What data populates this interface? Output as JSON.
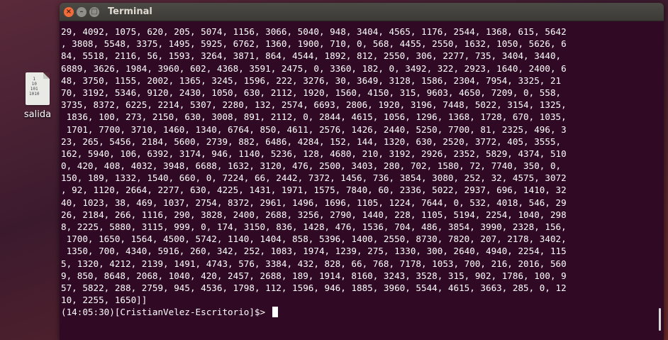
{
  "desktop": {
    "icon_label": "salida",
    "icon_glyph": "1\n10\n101\n1010"
  },
  "window": {
    "title": "Terminal",
    "close_glyph": "×",
    "min_glyph": "–",
    "max_glyph": "□"
  },
  "terminal": {
    "lines": [
      "29, 4092, 1075, 620, 205, 5074, 1156, 3066, 5040, 948, 3404, 4565, 1176, 2544, 1368, 615, 5642",
      ", 3808, 5548, 3375, 1495, 5925, 6762, 1360, 1900, 710, 0, 568, 4455, 2550, 1632, 1050, 5626, 6",
      "84, 5518, 2116, 56, 1593, 3264, 3871, 864, 4544, 1892, 812, 2550, 306, 2277, 735, 3404, 3440,",
      "6889, 3626, 1984, 3960, 602, 4368, 3591, 2475, 0, 3360, 182, 0, 3492, 322, 2923, 1640, 2400, 6",
      "48, 3750, 1155, 2002, 1365, 3245, 1596, 222, 3276, 30, 3649, 3128, 1586, 2304, 7954, 3325, 21",
      "70, 3192, 5346, 9120, 2430, 1050, 630, 2112, 1920, 1560, 4150, 315, 9603, 4650, 7209, 0, 558,",
      "3735, 8372, 6225, 2214, 5307, 2280, 132, 2574, 6693, 2806, 1920, 3196, 7448, 5022, 3154, 1325,",
      " 1836, 100, 273, 2150, 630, 3008, 891, 2112, 0, 2844, 4615, 1056, 1296, 1368, 1728, 670, 1035,",
      " 1701, 7700, 3710, 1460, 1340, 6764, 850, 4611, 2576, 1426, 2440, 5250, 7700, 81, 2325, 496, 3",
      "23, 265, 5456, 2184, 5600, 2739, 882, 6486, 4284, 152, 144, 1320, 630, 2520, 3772, 405, 3555,",
      "162, 5940, 106, 6392, 3174, 946, 1140, 5236, 128, 4680, 210, 3192, 2926, 2352, 5829, 4374, 510",
      "0, 420, 408, 4032, 3948, 6688, 1632, 3120, 476, 2500, 3403, 280, 702, 1580, 72, 7740, 350, 0,",
      "150, 189, 1332, 1540, 660, 0, 7224, 66, 2442, 7372, 1456, 736, 3854, 3080, 252, 32, 4575, 3072",
      ", 92, 1120, 2664, 2277, 630, 4225, 1431, 1971, 1575, 7840, 60, 2336, 5022, 2937, 696, 1410, 32",
      "40, 1023, 38, 469, 1037, 2754, 8372, 2961, 1496, 1696, 1105, 1224, 7644, 0, 532, 4018, 546, 29",
      "26, 2184, 266, 1116, 290, 3828, 2400, 2688, 3256, 2790, 1440, 228, 1105, 5194, 2254, 1040, 298",
      "8, 2225, 5880, 3115, 999, 0, 174, 3150, 836, 1428, 476, 1536, 704, 486, 3854, 3990, 2328, 156,",
      " 1700, 1650, 1564, 4500, 5742, 1140, 1404, 858, 5396, 1400, 2550, 8730, 7820, 207, 2178, 3402,",
      " 1350, 700, 4340, 5916, 260, 342, 252, 1083, 1974, 1239, 275, 1330, 300, 2640, 4940, 2254, 115",
      "5, 1320, 4212, 2139, 1491, 4743, 576, 3384, 432, 828, 66, 768, 7178, 1053, 700, 216, 2016, 560",
      "9, 850, 8648, 2068, 1040, 420, 2457, 2688, 189, 1914, 8160, 3243, 3528, 315, 902, 1786, 100, 9",
      "57, 5822, 288, 2759, 945, 4536, 1798, 112, 1596, 946, 1885, 3960, 5544, 4615, 3663, 285, 0, 12",
      "10, 2255, 1650]]"
    ],
    "prompt": "(14:05:30)[CristianVelez-Escritorio]$> "
  }
}
